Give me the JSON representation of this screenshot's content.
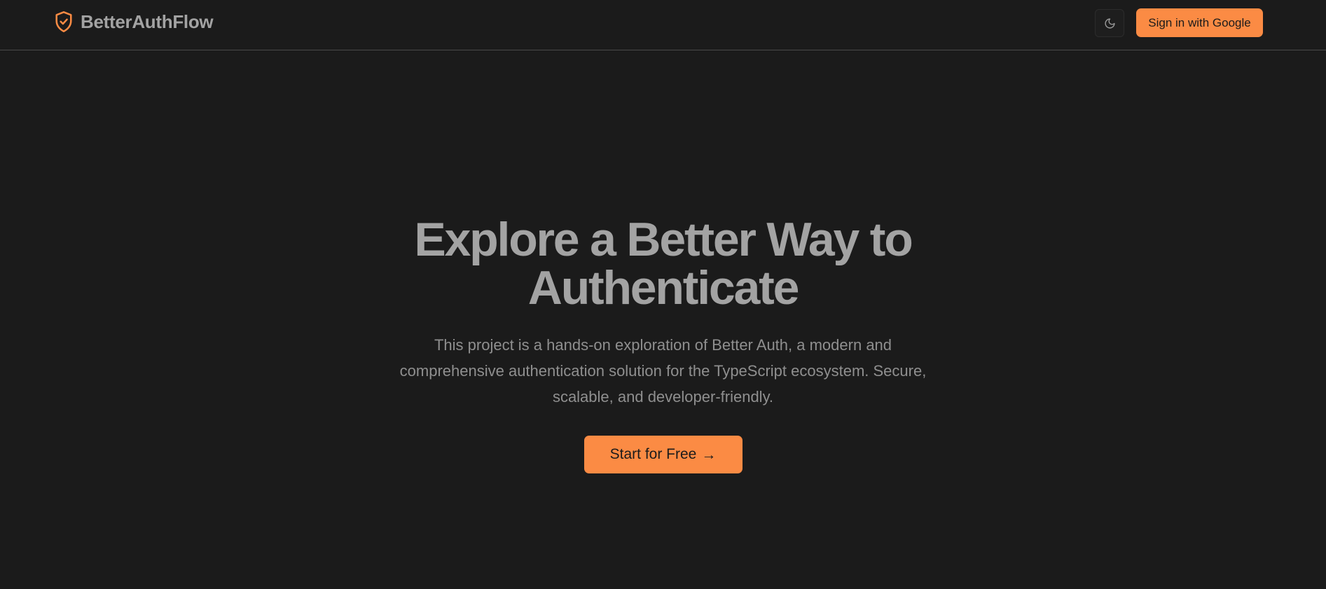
{
  "header": {
    "brand_name": "BetterAuthFlow",
    "brand_icon": "shield-check-icon",
    "theme_toggle_icon": "moon-icon",
    "signin_label": "Sign in with Google"
  },
  "hero": {
    "title": "Explore a Better Way to Authenticate",
    "description": "This project is a hands-on exploration of Better Auth, a modern and comprehensive authentication solution for the TypeScript ecosystem. Secure, scalable, and developer-friendly.",
    "cta_label": "Start for Free",
    "cta_icon": "arrow-right-icon",
    "cta_arrow": "→"
  },
  "colors": {
    "background": "#1b1b1b",
    "accent": "#fb8b44",
    "text_muted": "#a3a3a3",
    "border": "#4a4a4a"
  }
}
